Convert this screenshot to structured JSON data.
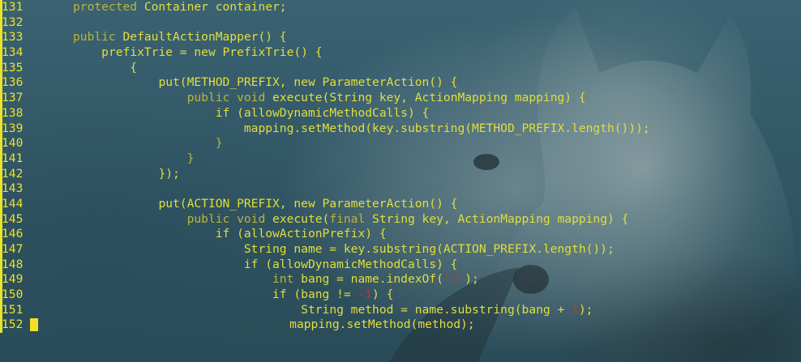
{
  "editor": {
    "accent_color": "#e8e32c",
    "lines": [
      {
        "num": "131",
        "indent": "",
        "segments": [
          {
            "t": "kw",
            "v": "protected"
          },
          {
            "t": "plain",
            "v": " Container container;"
          }
        ]
      },
      {
        "num": "132",
        "indent": "",
        "segments": []
      },
      {
        "num": "133",
        "indent": "",
        "segments": [
          {
            "t": "kw",
            "v": "public"
          },
          {
            "t": "plain",
            "v": " DefaultActionMapper() {"
          }
        ]
      },
      {
        "num": "134",
        "indent": "    ",
        "segments": [
          {
            "t": "plain",
            "v": "prefixTrie = new PrefixTrie() {"
          }
        ]
      },
      {
        "num": "135",
        "indent": "        ",
        "segments": [
          {
            "t": "plain",
            "v": "{"
          }
        ]
      },
      {
        "num": "136",
        "indent": "            ",
        "segments": [
          {
            "t": "plain",
            "v": "put(METHOD_PREFIX, new ParameterAction() {"
          }
        ]
      },
      {
        "num": "137",
        "indent": "                ",
        "segments": [
          {
            "t": "kw",
            "v": "public void"
          },
          {
            "t": "plain",
            "v": " execute(String key, ActionMapping mapping) {"
          }
        ]
      },
      {
        "num": "138",
        "indent": "                    ",
        "segments": [
          {
            "t": "plain",
            "v": "if (allowDynamicMethodCalls) {"
          }
        ]
      },
      {
        "num": "139",
        "indent": "                        ",
        "segments": [
          {
            "t": "plain",
            "v": "mapping.setMethod(key.substring(METHOD_PREFIX.length()));"
          }
        ]
      },
      {
        "num": "140",
        "indent": "                    ",
        "segments": [
          {
            "t": "kw",
            "v": "}"
          }
        ]
      },
      {
        "num": "141",
        "indent": "                ",
        "segments": [
          {
            "t": "kw",
            "v": "}"
          }
        ]
      },
      {
        "num": "142",
        "indent": "            ",
        "segments": [
          {
            "t": "plain",
            "v": "});"
          }
        ]
      },
      {
        "num": "143",
        "indent": "",
        "segments": []
      },
      {
        "num": "144",
        "indent": "            ",
        "segments": [
          {
            "t": "plain",
            "v": "put(ACTION_PREFIX, new ParameterAction() {"
          }
        ]
      },
      {
        "num": "145",
        "indent": "                ",
        "segments": [
          {
            "t": "kw",
            "v": "public void"
          },
          {
            "t": "plain",
            "v": " execute("
          },
          {
            "t": "kw",
            "v": "final"
          },
          {
            "t": "plain",
            "v": " String key, ActionMapping mapping) {"
          }
        ]
      },
      {
        "num": "146",
        "indent": "                    ",
        "segments": [
          {
            "t": "plain",
            "v": "if (allowActionPrefix) {"
          }
        ]
      },
      {
        "num": "147",
        "indent": "                        ",
        "segments": [
          {
            "t": "plain",
            "v": "String name = key.substring(ACTION_PREFIX.length());"
          }
        ]
      },
      {
        "num": "148",
        "indent": "                        ",
        "segments": [
          {
            "t": "plain",
            "v": "if (allowDynamicMethodCalls) {"
          }
        ]
      },
      {
        "num": "149",
        "indent": "                            ",
        "segments": [
          {
            "t": "kw",
            "v": "int"
          },
          {
            "t": "plain",
            "v": " bang = name.indexOf("
          },
          {
            "t": "str",
            "v": "'!'"
          },
          {
            "t": "plain",
            "v": ");"
          }
        ]
      },
      {
        "num": "150",
        "indent": "                            ",
        "segments": [
          {
            "t": "plain",
            "v": "if (bang != "
          },
          {
            "t": "num",
            "v": "-1"
          },
          {
            "t": "plain",
            "v": ") {"
          }
        ]
      },
      {
        "num": "151",
        "indent": "                                ",
        "segments": [
          {
            "t": "plain",
            "v": "String method = name.substring(bang + "
          },
          {
            "t": "num",
            "v": "1"
          },
          {
            "t": "plain",
            "v": ");"
          }
        ]
      },
      {
        "num": "152",
        "indent": "                                ",
        "segments": [
          {
            "t": "plain",
            "v": "mapping.setMethod(method);"
          }
        ],
        "cursor": true
      }
    ]
  }
}
